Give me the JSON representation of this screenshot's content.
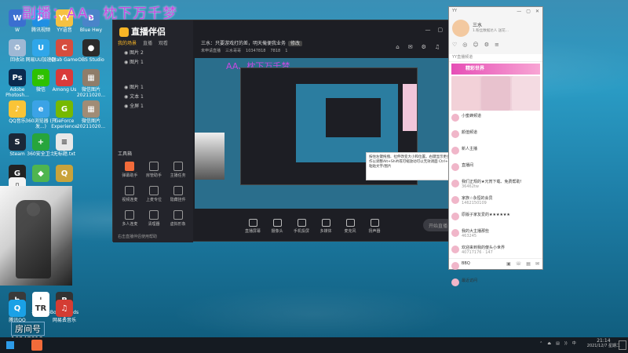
{
  "overlay_banner": "副播：AA、枕下万千梦",
  "desktop_icons": [
    {
      "label": "W",
      "color": "#3b6fd0",
      "glyph": "W"
    },
    {
      "label": "腾讯视频",
      "color": "#1f8fe3",
      "glyph": "▶"
    },
    {
      "label": "YY语音",
      "color": "#f6c142",
      "glyph": "YY"
    },
    {
      "label": "Blue Hwy",
      "color": "#4a84c9",
      "glyph": "B"
    },
    {
      "label": "回收站",
      "color": "#9fb8d4",
      "glyph": "♻"
    },
    {
      "label": "网易UU加速器",
      "color": "#2fa6e9",
      "glyph": "U"
    },
    {
      "label": "Crab Game",
      "color": "#d64d3e",
      "glyph": "C"
    },
    {
      "label": "OBS Studio",
      "color": "#2b2b2b",
      "glyph": "●"
    },
    {
      "label": "Adobe Photosh...",
      "color": "#0b2a4f",
      "glyph": "Ps"
    },
    {
      "label": "微信",
      "color": "#2dc100",
      "glyph": "✉"
    },
    {
      "label": "Among Us",
      "color": "#d93a3a",
      "glyph": "A"
    },
    {
      "label": "微信图片 20211020...",
      "color": "#8f7d6a",
      "glyph": "▦"
    },
    {
      "label": "QQ音乐",
      "color": "#f9c437",
      "glyph": "♪"
    },
    {
      "label": "360浏览器 (开发...)",
      "color": "#3ba3e6",
      "glyph": "e"
    },
    {
      "label": "GeForce Experience",
      "color": "#76b900",
      "glyph": "G"
    },
    {
      "label": "微信图片 20211020...",
      "color": "#a08c76",
      "glyph": "▦"
    },
    {
      "label": "Steam",
      "color": "#1b2838",
      "glyph": "S"
    },
    {
      "label": "360安全卫士",
      "color": "#27a53c",
      "glyph": "+"
    },
    {
      "label": "无标题.txt",
      "color": "#e8e8e8",
      "glyph": "≡"
    },
    {
      "label": "G",
      "color": "#222",
      "glyph": "G"
    },
    {
      "label": "",
      "color": "#4fb54f",
      "glyph": "◆"
    },
    {
      "label": "",
      "color": "#c9a33b",
      "glyph": "Q"
    },
    {
      "label": "",
      "color": "#f3f3f3",
      "glyph": "▯"
    },
    {
      "label": "百度Tv",
      "color": "#3a3a3a",
      "glyph": "b"
    },
    {
      "label": "手游助手",
      "color": "#ffffff",
      "glyph": "↓"
    },
    {
      "label": "Borderlands 3",
      "color": "#333",
      "glyph": "B"
    },
    {
      "label": "腾讯QQ",
      "color": "#1aa1e6",
      "glyph": "Q"
    },
    {
      "label": "",
      "color": "#fff",
      "glyph": "TR"
    },
    {
      "label": "网易云音乐",
      "color": "#d43c33",
      "glyph": "♫"
    }
  ],
  "app_window": {
    "logo_text": "直播伴侣",
    "side_tabs": [
      "我的场景",
      "直播",
      "观看"
    ],
    "active_side_tab": 0,
    "scenes": [
      "图片 2",
      "图片 1",
      "图片 1",
      "文本 1",
      "全屏 1"
    ],
    "tools_header": "工具箱",
    "tools": [
      {
        "label": "弹幕助手",
        "active": true
      },
      {
        "label": "房管助手",
        "active": false
      },
      {
        "label": "主播任务",
        "active": false
      },
      {
        "label": "视频连麦",
        "active": false
      },
      {
        "label": "上麦专位",
        "active": false
      },
      {
        "label": "隐藏挂件",
        "active": false
      },
      {
        "label": "多人连麦",
        "active": false
      },
      {
        "label": "清理器",
        "active": false
      },
      {
        "label": "虚拟形象",
        "active": false
      }
    ],
    "side_footer": "右击直播伴侣使用帮助",
    "room_title": "三水：只要游戏打的差，明天俺便我业务",
    "room_tag": "修改",
    "room_meta": [
      "未申请直播",
      "三水哥哥",
      "10347818",
      "7818",
      "1"
    ],
    "window_controls": [
      "—",
      "▢",
      "✕"
    ],
    "toolbar_icons": [
      "⌂",
      "✉",
      "⚙",
      "♫",
      "⇆"
    ],
    "preview_overlay_text": "AA、枕下万千梦",
    "tooltip_text": "按住左键拖拽、拉伸改变大小和位置。右键显示更多操作以调整Alt+Shift或可缩放动可以无效调面 Ctrl+V粘贴文字/图片",
    "bottom_tools": [
      "直播屏幕",
      "摄像头",
      "手机投屏",
      "多媒体",
      "麦克风",
      "扬声器"
    ],
    "start_button": "开始直播"
  },
  "chat_panel": {
    "app_badge": "YY",
    "window_controls": [
      "—",
      "▢",
      "✕"
    ],
    "user_name": "三水",
    "user_sub": "1.粉丝数据达人 送花...",
    "head_icons": [
      "♡",
      "◎",
      "☺",
      "⚙",
      "≡"
    ],
    "tab": "YY直播频道",
    "banner": "精彩世界",
    "messages": [
      {
        "title": "小蜜蜂频道",
        "meta": ""
      },
      {
        "title": "颜值频道",
        "meta": ""
      },
      {
        "title": "新人主播",
        "meta": ""
      },
      {
        "title": "直播间",
        "meta": ""
      },
      {
        "title": "我们正规的★元宵下载、免费帮助!",
        "meta": "36462tw"
      },
      {
        "title": "家族☆永恒的会员",
        "meta": "1462150109"
      },
      {
        "title": "原版子家友爱的★★★★★★",
        "meta": ""
      },
      {
        "title": "我的大主播那些",
        "meta": "463245"
      },
      {
        "title": "欢迎来到我的傻头小世界",
        "meta": "40717176 · 147"
      },
      {
        "title": "BBQ",
        "meta": ""
      },
      {
        "title": "最近访问",
        "meta": ""
      }
    ],
    "footer_icons": [
      "▣",
      "☏",
      "▤",
      "✉"
    ]
  },
  "room_number": {
    "label": "房间号",
    "value": "10347818"
  },
  "taskbar": {
    "tray_icons": [
      "⌃",
      "⏏",
      "▤",
      "))",
      "中"
    ],
    "time": "21:14",
    "date": "2021/12/7 星期二"
  }
}
